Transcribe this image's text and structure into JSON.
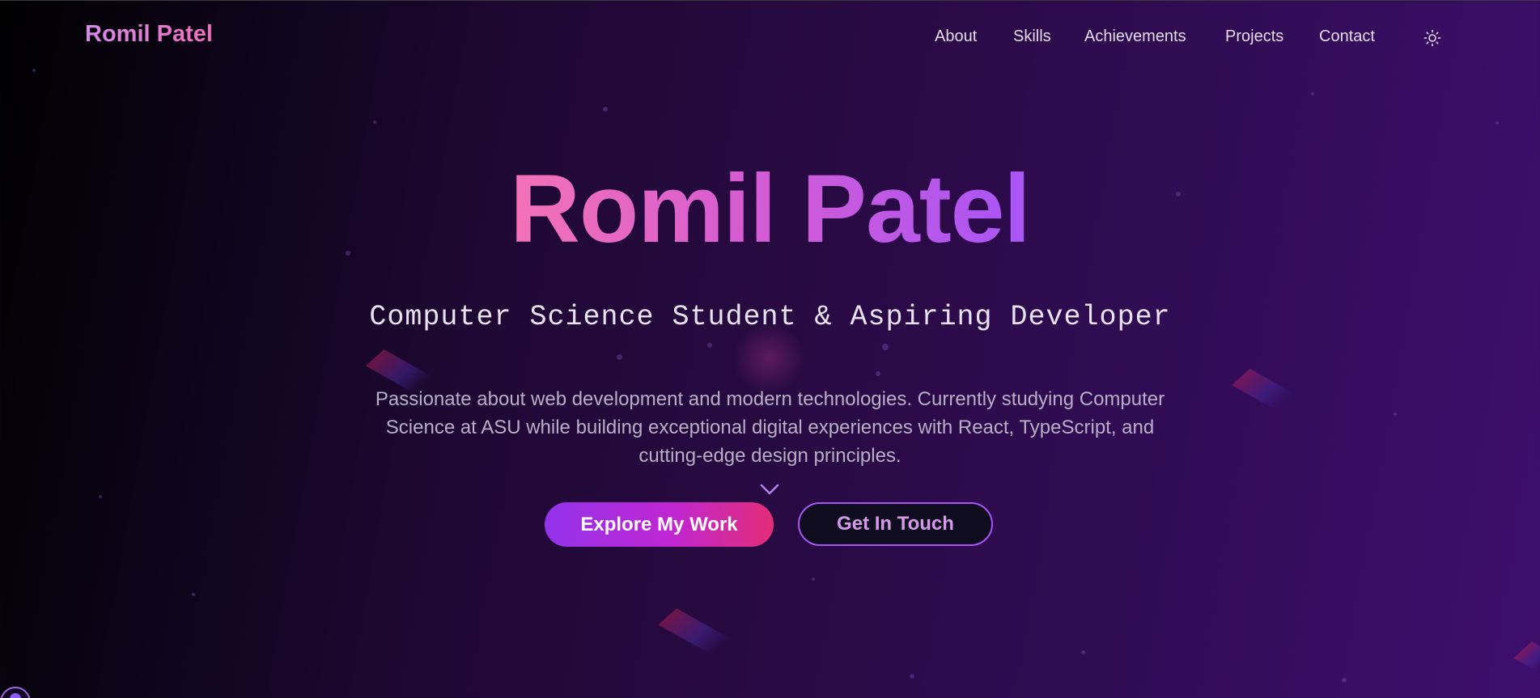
{
  "header": {
    "logo": "Romil Patel",
    "nav": [
      {
        "label": "About"
      },
      {
        "label": "Skills"
      },
      {
        "label": "Achievements"
      },
      {
        "label": "Projects"
      },
      {
        "label": "Contact"
      }
    ],
    "theme_toggle_icon": "sun-icon"
  },
  "hero": {
    "title": "Romil Patel",
    "subtitle": "Computer Science Student & Aspiring Developer",
    "description": "Passionate about web development and modern technologies. Currently studying Computer Science at ASU while building exceptional digital experiences with React, TypeScript, and cutting-edge design principles.",
    "scroll_icon": "chevron-down-icon",
    "primary_button": "Explore My Work",
    "secondary_button": "Get In Touch"
  },
  "colors": {
    "accent_pink": "#f472b6",
    "accent_purple": "#a855f7",
    "background_dark": "#000000",
    "background_violet": "#3e0f6e"
  }
}
